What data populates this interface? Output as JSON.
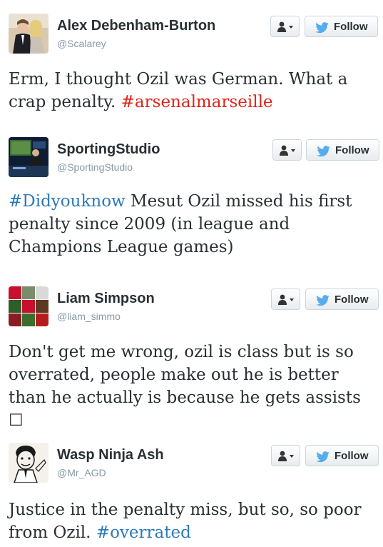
{
  "tweets": [
    {
      "name": "Alex Debenham-Burton",
      "handle": "@Scalarey",
      "follow_label": "Follow",
      "text_before": "Erm, I thought Ozil was German. What a crap penalty. ",
      "hashtag": "#arsenalmarseille",
      "hashtag_color": "#e2231a",
      "text_after": ""
    },
    {
      "name": "SportingStudio",
      "handle": "@SportingStudio",
      "follow_label": "Follow",
      "hashtag": "#Didyouknow",
      "hashtag_color": "#2b7bb9",
      "text_after": " Mesut Ozil missed his first penalty since 2009 (in league and Champions League games)"
    },
    {
      "name": "Liam Simpson",
      "handle": "@liam_simmo",
      "follow_label": "Follow",
      "text": "Don't get me wrong, ozil is class but is so overrated, people make out he is better than he actually is because he gets assists ☐"
    },
    {
      "name": "Wasp Ninja Ash",
      "handle": "@Mr_AGD",
      "follow_label": "Follow",
      "text_before": "Justice in the penalty miss, but so, so poor from Ozil. ",
      "hashtag": "#overrated",
      "hashtag_color": "#2b7bb9"
    }
  ],
  "colors": {
    "name": "#292f33",
    "handle": "#8899a6",
    "twitter_blue": "#55acee",
    "button_border": "#ccd6dd"
  },
  "icons": [
    "person-icon",
    "dropdown-caret-icon",
    "twitter-bird-icon"
  ]
}
